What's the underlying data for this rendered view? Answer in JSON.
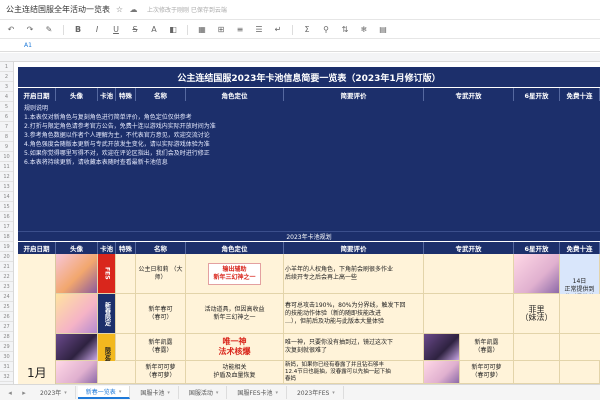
{
  "app": {
    "doc_title": "公主连结国服全年活动一览表",
    "saved_note": "上次修改于刚刚 已保存到云端"
  },
  "formula": {
    "cell_ref": "A1"
  },
  "sheet": {
    "title": "公主连结国服2023年卡池信息简要一览表（2023年1月修订版）",
    "columns": [
      "开启日期",
      "头像",
      "卡池",
      "特殊",
      "名称",
      "角色定位",
      "简要评价",
      "专武开放",
      "6星开放",
      "免费十连"
    ],
    "notes": [
      "规则说明",
      "1.本表仅对新角色与复刻角色进行简单评价，角色定位仅供参考",
      "2.打折与限定角色请参考官方公告，免费十连以游戏内实际开放时间为准",
      "3.参考角色数据以作者个人理解为主，不代表官方意见，欢迎交流讨论",
      "4.角色强度会随版本更新与专武开放发生变化，请以实际游戏体验为准",
      "5.如果你觉得哪里写得不对，欢迎在评论区指出，我们会及时进行修正",
      "6.本表将持续更新，请收藏本表随时查看最新卡池信息"
    ],
    "year_bar": "2023年卡池规划",
    "month_label": "1月"
  },
  "rows": [
    {
      "pool": "FES",
      "name": "公主日和莉\n（大师）",
      "role": "输出辅助\n新年三幻神之一",
      "eval": "小羊年的人权角色，下角前会刷很多作业\n后续开专之后会再上高一些",
      "exclusive": "",
      "six_star": "",
      "free_ten": "14日\n正常提供到\n收到最终的\n第一天"
    },
    {
      "pool": "新春限定",
      "name": "新年春可\n（春可）",
      "role": "活动道具，但因高收益\n新年三幻神之一",
      "eval": "春可总攻击190%，80%为分界线，触发下回\n的技能动作体验（新的随即技能改进\n…），但前后及功能与此版本大量体验",
      "exclusive": "",
      "six_star": "菲里\n（妹法）",
      "free_ten": ""
    },
    {
      "pool": "限定复刻",
      "name": "新年凯露\n（春露）",
      "role": "唯一神\n法术核爆",
      "eval": "唯一神，只要你没有抽到过，镜过这次下\n次复刻就很难了",
      "exclusive": "新年凯露\n（春露）",
      "six_star": "",
      "free_ten": ""
    },
    {
      "pool": "",
      "name": "新年可可萝\n（春可萝）",
      "role": "功能相关\n护盾及血量恢复",
      "eval": "新妈，如果你已经有春露了并且钻石够丰\n12.4节日也能抽，没春露可以先抽一起下抽\n春妈",
      "exclusive": "新年可可萝\n（春可萝）",
      "six_star": "",
      "free_ten": ""
    }
  ],
  "tabs": [
    "2023年",
    "新春一览表",
    "国服卡池",
    "国服活动",
    "国服FES卡池",
    "2023年FES"
  ],
  "active_tab": 1,
  "row_numbers": [
    "1",
    "2",
    "3",
    "4",
    "5",
    "6",
    "7",
    "8",
    "9",
    "10",
    "11",
    "12",
    "13",
    "14",
    "15",
    "16",
    "17",
    "18",
    "19",
    "20",
    "21",
    "22",
    "23",
    "24",
    "25",
    "26",
    "27",
    "28",
    "29",
    "30",
    "31",
    "32"
  ]
}
